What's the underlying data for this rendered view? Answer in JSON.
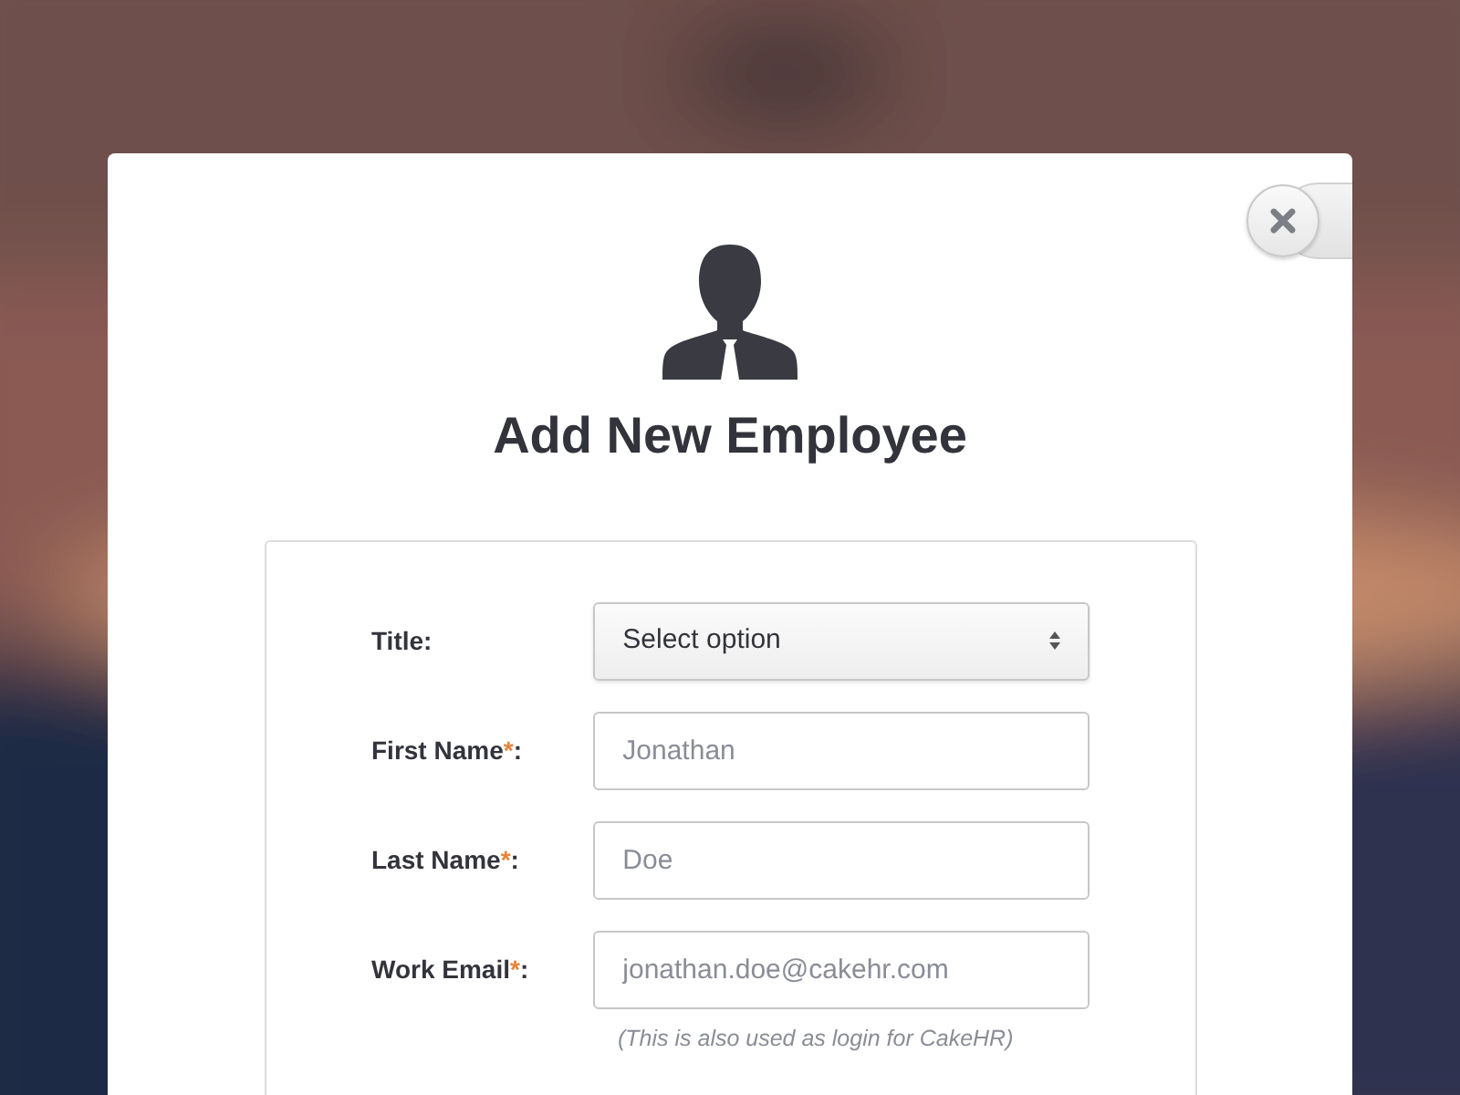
{
  "modal": {
    "title": "Add New Employee",
    "fields": [
      {
        "kind": "select",
        "label": "Title:",
        "value": "Select option"
      },
      {
        "kind": "text",
        "label": "First Name",
        "required_mark": "*",
        "label_end": ":",
        "placeholder": "Jonathan"
      },
      {
        "kind": "text",
        "label": "Last Name",
        "required_mark": "*",
        "label_end": ":",
        "placeholder": "Doe"
      },
      {
        "kind": "text",
        "label": "Work Email",
        "required_mark": "*",
        "label_end": ":",
        "placeholder": "jonathan.doe@cakehr.com",
        "hint": "(This is also used as login for CakeHR)"
      }
    ]
  }
}
